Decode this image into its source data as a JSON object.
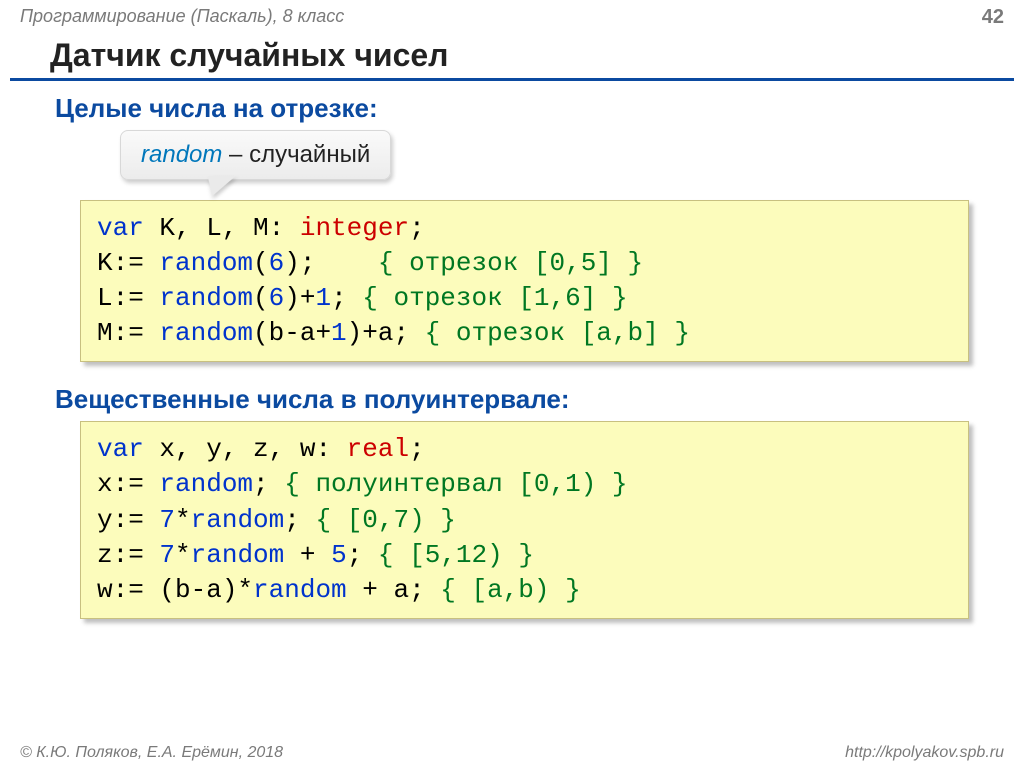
{
  "meta": {
    "course": "Программирование (Паскаль), 8 класс",
    "page": "42",
    "copyright": "© К.Ю. Поляков, Е.А. Ерёмин, 2018",
    "url": "http://kpolyakov.spb.ru"
  },
  "title": "Датчик случайных чисел",
  "section1": {
    "heading": "Целые числа на отрезке:"
  },
  "callout": {
    "word": "random",
    "sep": " – ",
    "meaning": "случайный"
  },
  "code1": {
    "l1a": "var",
    "l1b": " K, L, M: ",
    "l1c": "integer",
    "l1d": ";",
    "l2a": "K:=",
    "l2b": " random",
    "l2c": "(",
    "l2d": "6",
    "l2e": ");    ",
    "l2f": "{ отрезок [0,5] }",
    "l3a": "L:=",
    "l3b": " random",
    "l3c": "(",
    "l3d": "6",
    "l3e": ")+",
    "l3f": "1",
    "l3g": "; ",
    "l3h": "{ отрезок [1,6] }",
    "l4a": "M:=",
    "l4b": " random",
    "l4c": "(b-a+",
    "l4d": "1",
    "l4e": ")+a; ",
    "l4f": "{ отрезок [a,b] }"
  },
  "section2": {
    "heading": "Вещественные числа в полуинтервале:"
  },
  "code2": {
    "l1a": "var",
    "l1b": " x, y, z, w: ",
    "l1c": "real",
    "l1d": ";",
    "l2a": "x:=",
    "l2b": " random",
    "l2c": "; ",
    "l2d": "{ полуинтервал [0,1) }",
    "l3a": "y:=",
    "l3b": " 7",
    "l3c": "*",
    "l3d": "random",
    "l3e": "; ",
    "l3f": "{ [0,7) }",
    "l4a": "z:=",
    "l4b": " 7",
    "l4c": "*",
    "l4d": "random",
    "l4e": " + ",
    "l4f": "5",
    "l4g": "; ",
    "l4h": "{ [5,12) }",
    "l5a": "w:=",
    "l5b": " (b-a)*",
    "l5c": "random",
    "l5d": " + a; ",
    "l5e": "{ [a,b) }"
  }
}
